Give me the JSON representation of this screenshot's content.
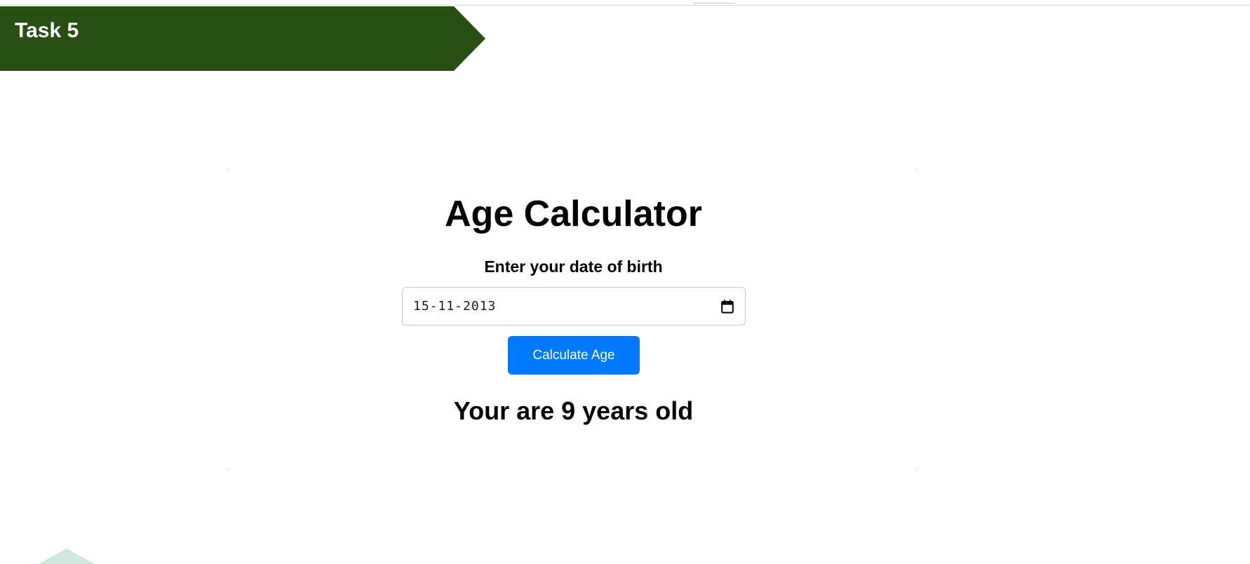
{
  "banner": {
    "label": "Task 5",
    "color": "#294f14"
  },
  "app": {
    "title": "Age Calculator",
    "dob_label": "Enter your date of birth",
    "date_value": "15-11-2013",
    "calendar_icon": "calendar-icon",
    "button_label": "Calculate Age",
    "button_color": "#007bff",
    "result": "Your are 9 years old"
  }
}
